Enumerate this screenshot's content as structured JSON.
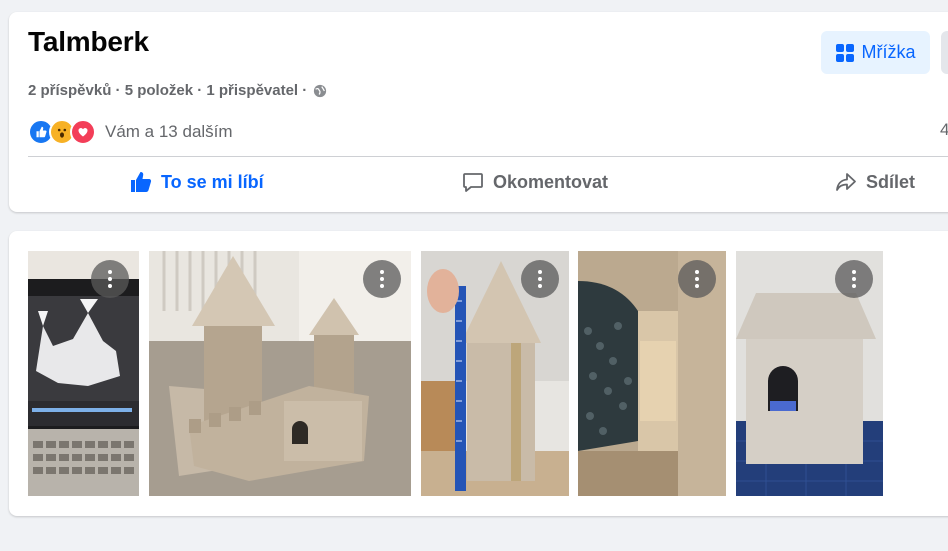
{
  "album": {
    "title": "Talmberk",
    "meta": "2 příspěvků · 5 položek · 1 přispěvatel ·",
    "privacy_icon": "globe-icon"
  },
  "view_button": {
    "label": "Mřížka",
    "icon": "grid-icon"
  },
  "reactions": {
    "types": [
      "like",
      "wow",
      "love"
    ],
    "text": "Vám a 13 dalším",
    "right_count": "4"
  },
  "actions": {
    "like": "To se mi líbí",
    "comment": "Okomentovat",
    "share": "Sdílet"
  },
  "photos": [
    {
      "name": "photo-3d-model-laptop"
    },
    {
      "name": "photo-castle-model-wide"
    },
    {
      "name": "photo-tower-with-ruler"
    },
    {
      "name": "photo-gate-tunnel"
    },
    {
      "name": "photo-house-model"
    }
  ],
  "colors": {
    "accent": "#0866ff",
    "accent_bg": "#e7f3ff",
    "muted": "#65676b"
  }
}
